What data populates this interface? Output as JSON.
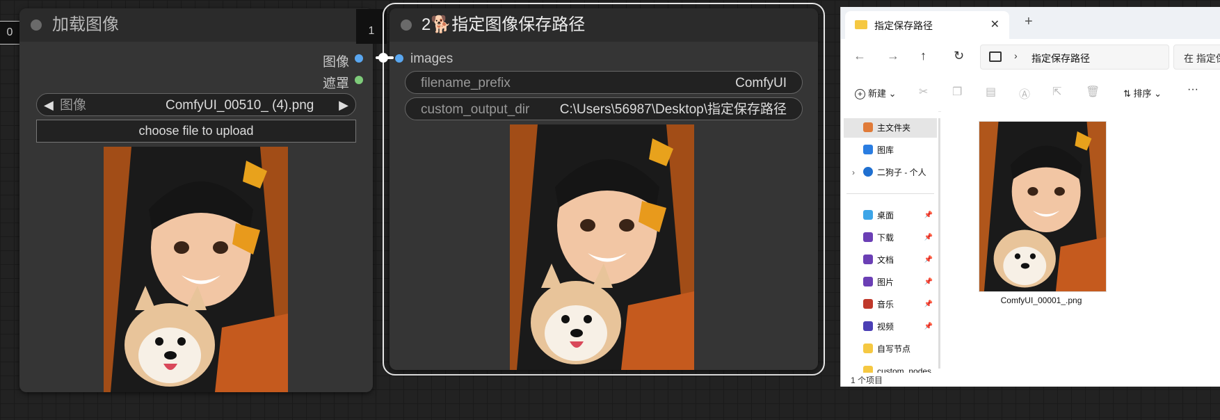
{
  "load_node": {
    "id_tag": "0",
    "title": "加载图像",
    "outputs": [
      "图像",
      "遮罩"
    ],
    "image_widget": {
      "name": "图像",
      "value": "ComfyUI_00510_ (4).png"
    },
    "upload_button": "choose file to upload"
  },
  "save_node": {
    "id_tag": "1",
    "title": "2🐕指定图像保存路径",
    "input_label": "images",
    "widgets": [
      {
        "name": "filename_prefix",
        "value": "ComfyUI"
      },
      {
        "name": "custom_output_dir",
        "value": "C:\\Users\\56987\\Desktop\\指定保存路径"
      }
    ]
  },
  "explorer": {
    "tab_title": "指定保存路径",
    "tab_close": "✕",
    "tab_add": "+",
    "address": "指定保存路径",
    "search_placeholder": "在 指定保",
    "new_label": "新建",
    "sort_label": "排序",
    "more": "···",
    "sidebar": [
      {
        "label": "主文件夹",
        "icon": "home-icon",
        "color": "#e07b39",
        "active": true
      },
      {
        "label": "图库",
        "icon": "gallery-icon",
        "color": "#2a7de1"
      },
      {
        "label": "二狗子 - 个人",
        "icon": "cloud-icon",
        "color": "#1f6fd0"
      },
      {
        "label": "桌面",
        "icon": "desktop-icon",
        "color": "#3da5e8",
        "pinned": true
      },
      {
        "label": "下载",
        "icon": "download-icon",
        "color": "#6b3fb5",
        "pinned": true
      },
      {
        "label": "文档",
        "icon": "document-icon",
        "color": "#6b3fb5",
        "pinned": true
      },
      {
        "label": "图片",
        "icon": "pictures-icon",
        "color": "#6b3fb5",
        "pinned": true
      },
      {
        "label": "音乐",
        "icon": "music-icon",
        "color": "#c0392b",
        "pinned": true
      },
      {
        "label": "视频",
        "icon": "video-icon",
        "color": "#4b3fb5",
        "pinned": true
      },
      {
        "label": "自写节点",
        "icon": "folder-icon",
        "color": "#f5c842"
      },
      {
        "label": "custom_nodes",
        "icon": "folder-icon",
        "color": "#f5c842"
      }
    ],
    "file_name": "ComfyUI_00001_.png",
    "status": "1 个项目"
  }
}
